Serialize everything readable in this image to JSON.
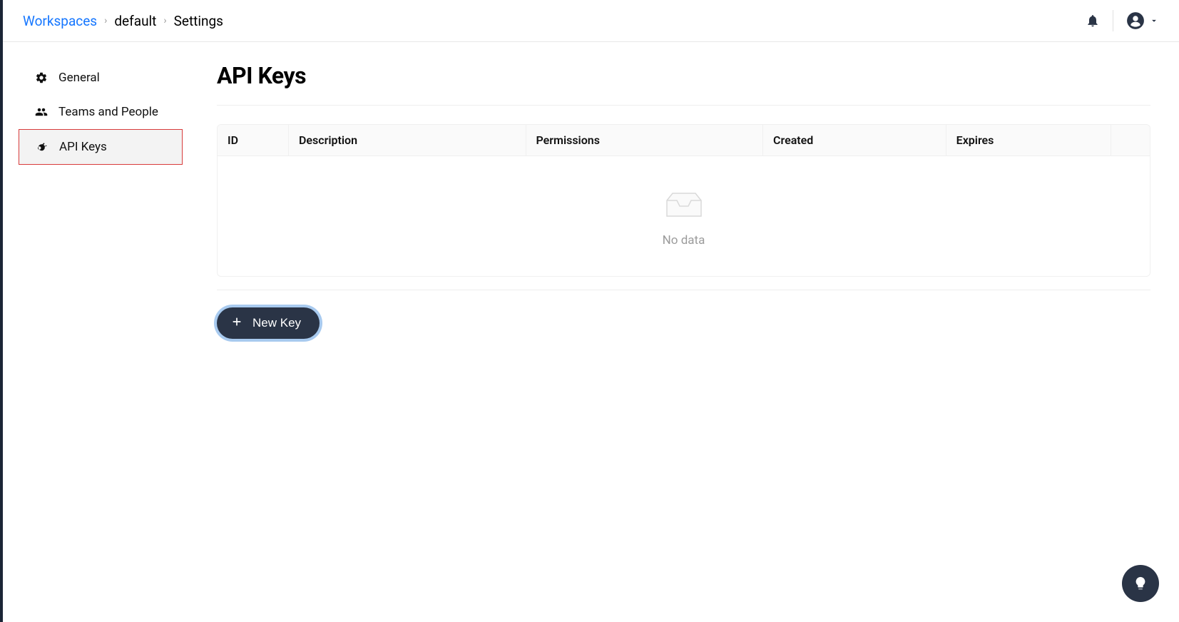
{
  "breadcrumbs": {
    "root": "Workspaces",
    "workspace": "default",
    "current": "Settings"
  },
  "sidebar": {
    "items": [
      {
        "label": "General"
      },
      {
        "label": "Teams and People"
      },
      {
        "label": "API Keys"
      }
    ]
  },
  "main": {
    "title": "API Keys",
    "columns": {
      "id": "ID",
      "description": "Description",
      "permissions": "Permissions",
      "created": "Created",
      "expires": "Expires"
    },
    "empty_text": "No data",
    "new_key_label": "New Key"
  }
}
